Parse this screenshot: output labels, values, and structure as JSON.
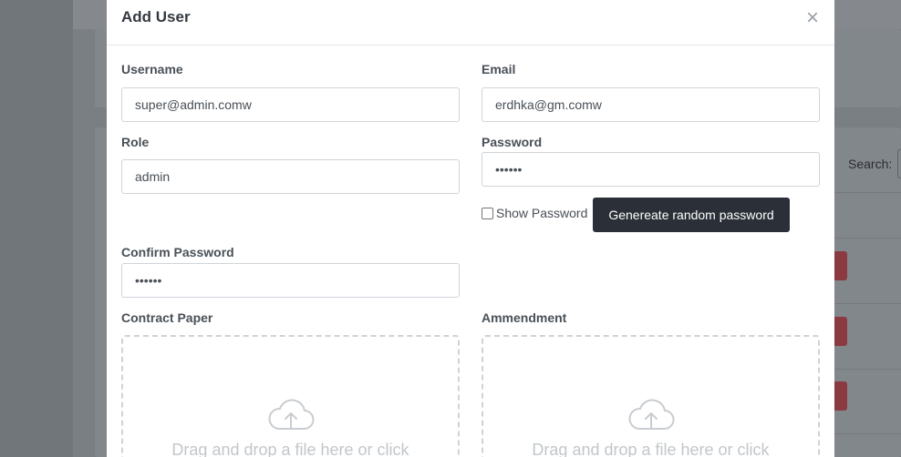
{
  "background": {
    "search_label": "Search:"
  },
  "modal": {
    "title": "Add User",
    "close_symbol": "×",
    "fields": {
      "username": {
        "label": "Username",
        "value": "super@admin.comw"
      },
      "email": {
        "label": "Email",
        "value": "erdhka@gm.comw"
      },
      "role": {
        "label": "Role",
        "value": "admin"
      },
      "password": {
        "label": "Password",
        "value": "••••••"
      },
      "confirm_password": {
        "label": "Confirm Password",
        "value": "••••••"
      }
    },
    "show_password": {
      "label": "Show Password",
      "checked": false
    },
    "generate_button_label": "Genereate random password",
    "uploads": {
      "contract": {
        "label": "Contract Paper",
        "prompt": "Drag and drop a file here or click"
      },
      "ammendment": {
        "label": "Ammendment",
        "prompt": "Drag and drop a file here or click"
      }
    }
  },
  "colors": {
    "primary_button": "#2b3038",
    "delete_button": "#dc3545"
  },
  "icons": {
    "upload": "cloud-upload-icon",
    "close": "close-icon"
  }
}
